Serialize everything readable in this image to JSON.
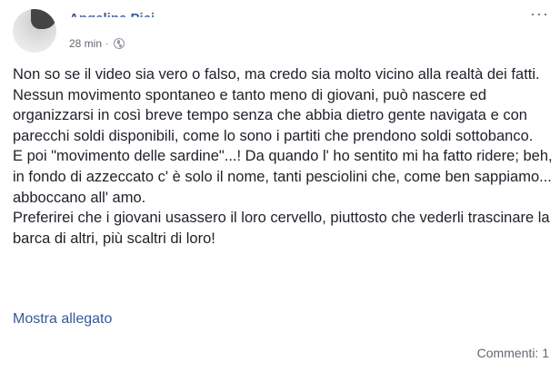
{
  "post": {
    "author": "Angelina Pici",
    "time": "28 min",
    "separator": "·",
    "privacy_icon": "globe-icon",
    "options_icon": "more-options-icon",
    "options_glyph": "···",
    "paragraphs": [
      "Non so se il video sia vero o falso, ma credo sia molto vicino alla realtà dei fatti.",
      "Nessun movimento spontaneo e tanto meno di giovani, può nascere ed organizzarsi in così breve tempo senza che abbia dietro gente navigata e con parecchi soldi disponibili, come lo sono i partiti che prendono soldi sottobanco.",
      "E poi \"movimento delle sardine\"...! Da quando l' ho sentito mi ha fatto ridere; beh, in fondo di azzeccato c' è solo il nome, tanti pesciolini che, come ben sappiamo... abboccano all' amo.",
      "Preferirei che i giovani usassero il loro cervello, piuttosto che vederli trascinare la barca di altri, più scaltri di loro!"
    ],
    "see_attachment": "Mostra allegato",
    "comments": "Commenti: 1"
  },
  "colors": {
    "link": "#385898",
    "text": "#1d2129",
    "meta": "#616770"
  }
}
